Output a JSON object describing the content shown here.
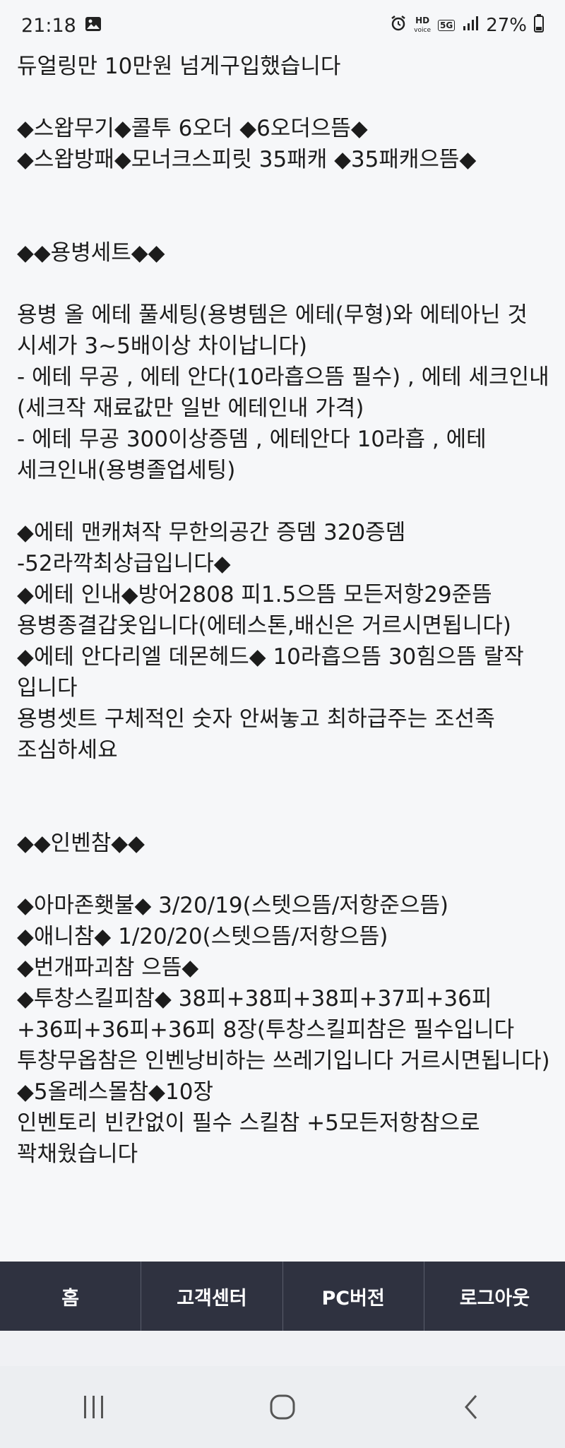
{
  "status_bar": {
    "time": "21:18",
    "hd_top": "HD",
    "hd_bottom": "voice",
    "network": "5G",
    "battery": "27%",
    "icons": [
      "image-icon",
      "alarm-icon",
      "signal-icon",
      "battery-icon"
    ]
  },
  "post": {
    "lines": [
      "듀얼링만 10만원 넘게구입했습니다",
      "",
      "◆스왑무기◆콜투 6오더 ◆6오더으뜸◆",
      "◆스왑방패◆모너크스피릿 35패캐 ◆35패캐으뜸◆",
      "",
      "",
      "◆◆용병세트◆◆",
      "",
      "용병 올 에테 풀세팅(용병템은 에테(무형)와 에테아닌 것 시세가 3~5배이상 차이납니다)",
      "- 에테 무공 , 에테 안다(10라흡으뜸 필수) , 에테 세크인내(세크작 재료값만 일반 에테인내 가격)",
      "- 에테 무공 300이상증뎀 , 에테안다 10라흡 , 에테 세크인내(용병졸업세팅)",
      "",
      "◆에테 맨캐쳐작 무한의공간 증뎀 320증뎀 -52라깍최상급입니다◆",
      "◆에테 인내◆방어2808 피1.5으뜸 모든저항29준뜸 용병종결갑옷입니다(에테스톤,배신은 거르시면됩니다)",
      "◆에테 안다리엘 데몬헤드◆ 10라흡으뜸 30힘으뜸 랄작 입니다",
      "용병셋트 구체적인 숫자 안써놓고 최하급주는 조선족 조심하세요",
      "",
      "",
      "◆◆인벤참◆◆",
      "",
      "◆아마존횃불◆ 3/20/19(스텟으뜸/저항준으뜸)",
      "◆애니참◆ 1/20/20(스텟으뜸/저항으뜸)",
      "◆번개파괴참 으뜸◆",
      "◆투창스킬피참◆ 38피+38피+38피+37피+36피+36피+36피+36피 8장(투창스킬피참은 필수입니다 투창무옵참은 인벤낭비하는 쓰레기입니다 거르시면됩니다)",
      "◆5올레스몰참◆10장",
      "인벤토리 빈칸없이 필수 스킬참 +5모든저항참으로 꽉채웠습니다"
    ]
  },
  "bottom_nav": {
    "items": [
      "홈",
      "고객센터",
      "PC버전",
      "로그아웃"
    ]
  },
  "system_nav": {
    "icons": [
      "recent-apps-icon",
      "home-circle-icon",
      "back-icon"
    ]
  }
}
